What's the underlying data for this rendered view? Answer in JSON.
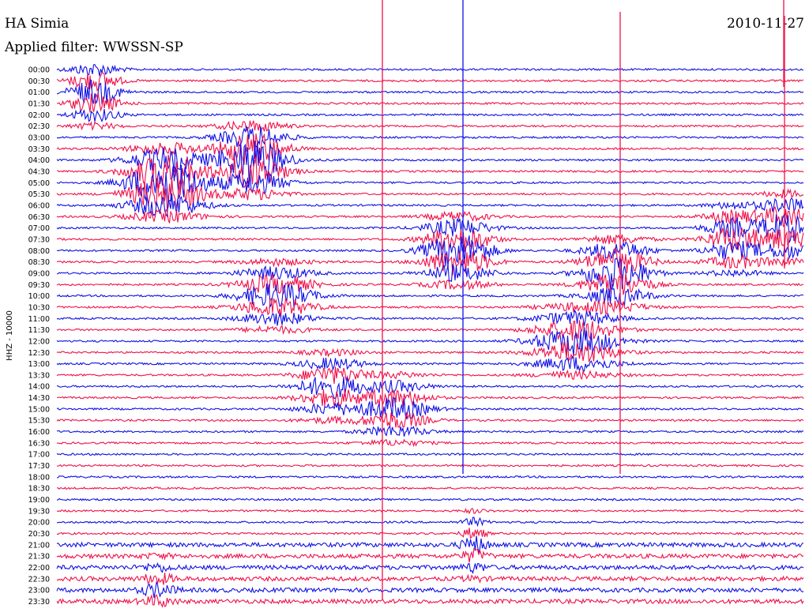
{
  "header": {
    "station": "HA Simia",
    "date": "2010-11-27",
    "filter": "Applied filter: WWSSN-SP"
  },
  "chart_data": {
    "type": "line",
    "title": "HA Simia",
    "ylabel": "HHZ - 10000",
    "colors": [
      "#1010e6",
      "#f0104a"
    ],
    "row_labels": [
      "00:00",
      "00:30",
      "01:00",
      "01:30",
      "02:00",
      "02:30",
      "03:00",
      "03:30",
      "04:00",
      "04:30",
      "05:00",
      "05:30",
      "06:00",
      "06:30",
      "07:00",
      "07:30",
      "08:00",
      "08:30",
      "09:00",
      "09:30",
      "10:00",
      "10:30",
      "11:00",
      "11:30",
      "12:00",
      "12:30",
      "13:00",
      "13:30",
      "14:00",
      "14:30",
      "15:00",
      "15:30",
      "16:00",
      "16:30",
      "17:00",
      "17:30",
      "18:00",
      "18:30",
      "19:00",
      "19:30",
      "20:00",
      "20:30",
      "21:00",
      "21:30",
      "22:00",
      "22:30",
      "23:00",
      "23:30"
    ]
  }
}
